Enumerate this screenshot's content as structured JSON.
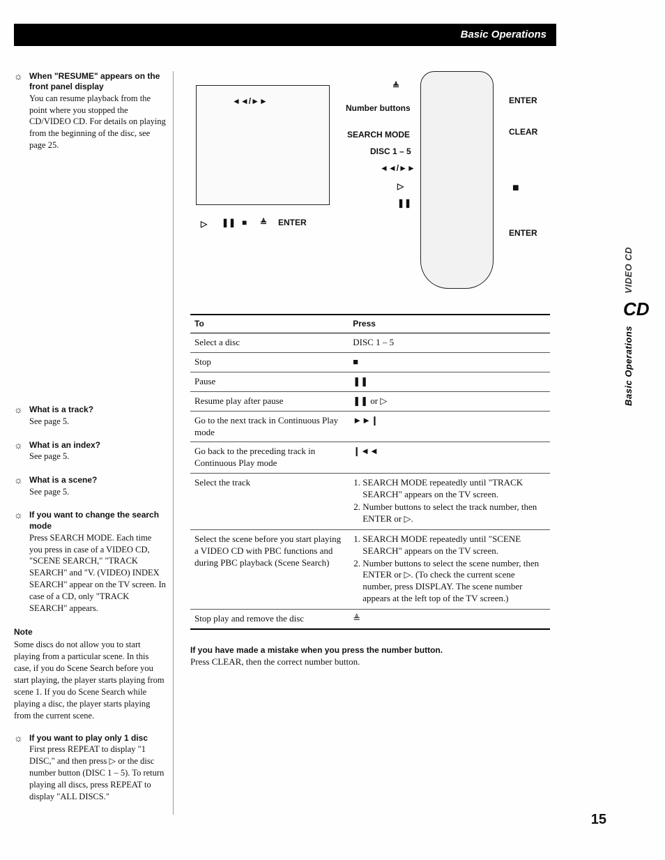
{
  "header": {
    "title": "Basic Operations"
  },
  "side_tabs": {
    "video": "VIDEO CD",
    "cd": "CD",
    "section": "Basic Operations"
  },
  "page_number": "15",
  "tips": [
    {
      "title": "When \"RESUME\" appears on the front panel display",
      "body": "You can resume playback from the point where you stopped the CD/VIDEO CD. For details on playing from the beginning of the disc, see page 25."
    },
    {
      "title": "What is a track?",
      "body": "See page 5."
    },
    {
      "title": "What is an index?",
      "body": "See page 5."
    },
    {
      "title": "What is a scene?",
      "body": "See page 5."
    },
    {
      "title": "If you want to change the search mode",
      "body": "Press SEARCH MODE. Each time you press in case of a VIDEO CD, \"SCENE SEARCH,\" \"TRACK SEARCH\" and \"V. (VIDEO) INDEX SEARCH\" appear on the TV screen. In case of a CD, only \"TRACK SEARCH\" appears."
    }
  ],
  "note": {
    "title": "Note",
    "body": "Some discs do not allow you to start playing from a particular scene. In this case, if you do Scene Search before you start playing, the player starts playing from scene 1. If you do Scene Search while playing a disc, the player starts playing from the current scene."
  },
  "tip_bottom": {
    "title": "If you want to play only 1 disc",
    "body": "First press REPEAT to display \"1 DISC,\" and then press ▷ or the disc number button (DISC 1 – 5). To return playing all discs, press REPEAT to display \"ALL DISCS.\""
  },
  "diagram_labels": {
    "eject": "≜",
    "skip": "◄◄/►►",
    "num": "Number buttons",
    "search": "SEARCH MODE",
    "disc": "DISC 1 – 5",
    "play": "▷",
    "pause": "❚❚",
    "stop": "■",
    "enter1": "ENTER",
    "enter2": "ENTER",
    "enter3": "ENTER",
    "clear": "CLEAR"
  },
  "table": {
    "head": {
      "to": "To",
      "press": "Press"
    },
    "rows": [
      {
        "to": "Select a disc",
        "press": "DISC 1 – 5"
      },
      {
        "to": "Stop",
        "press": "■"
      },
      {
        "to": "Pause",
        "press": "❚❚"
      },
      {
        "to": "Resume play after pause",
        "press": "❚❚ or ▷"
      },
      {
        "to": "Go to the next track in Continuous Play mode",
        "press": "►►❙"
      },
      {
        "to": "Go back to the preceding track in Continuous Play mode",
        "press": "❙◄◄"
      },
      {
        "to": "Select the track",
        "press_list": [
          "SEARCH MODE repeatedly until \"TRACK SEARCH\" appears on the TV screen.",
          "Number buttons to select the track number, then ENTER or ▷."
        ]
      },
      {
        "to": "Select the scene before you start playing a VIDEO CD with PBC functions and during PBC playback (Scene Search)",
        "press_list": [
          "SEARCH MODE repeatedly until \"SCENE SEARCH\" appears on the TV screen.",
          "Number buttons to select the scene number, then ENTER or ▷. (To check the current scene number, press DISPLAY. The scene number appears at the left top of the TV screen.)"
        ]
      },
      {
        "to": "Stop play and remove the disc",
        "press": "≜"
      }
    ]
  },
  "footer": {
    "bold": "If you have made a mistake when you press the number button.",
    "body": "Press CLEAR, then the correct number button."
  }
}
